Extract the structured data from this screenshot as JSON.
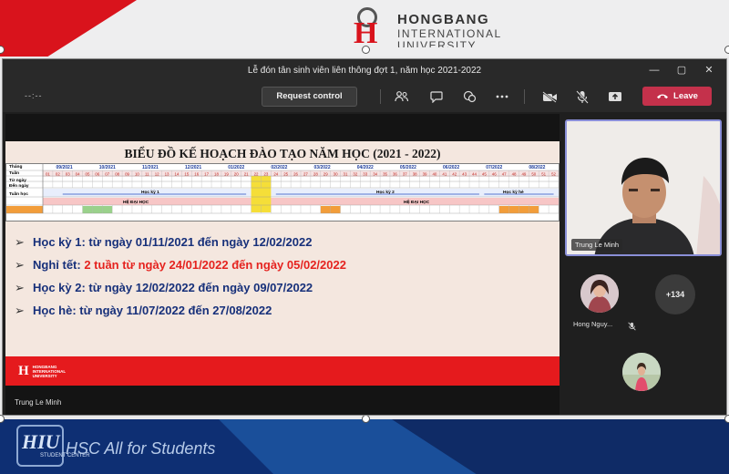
{
  "branding": {
    "logo_name": "HONGBANG",
    "logo_line2": "INTERNATIONAL",
    "logo_line3": "UNIVERSITY",
    "footer_logo": "HIU",
    "footer_logo_sub": "STUDENT CENTER",
    "slogan": "HSC All for Students"
  },
  "window": {
    "title": "Lễ đón tân sinh viên liên thông đợt 1, năm học 2021-2022",
    "controls": [
      "—",
      "▢",
      "✕"
    ]
  },
  "toolbar": {
    "timer": "--:--",
    "request_control": "Request control",
    "icons": [
      "people-icon",
      "chat-icon",
      "reactions-icon",
      "more-icon",
      "camera-off-icon",
      "mic-off-icon",
      "share-icon"
    ],
    "leave_label": "Leave"
  },
  "slide": {
    "title": "BIỂU ĐỒ KẾ HOẠCH ĐÀO TẠO NĂM HỌC (2021 - 2022)",
    "calendar": {
      "row_labels": [
        "Tháng",
        "Tuần",
        "Từ ngày",
        "Đến ngày",
        "Tuần học"
      ],
      "months": [
        "09/2021",
        "10/2021",
        "11/2021",
        "12/2021",
        "01/2022",
        "02/2022",
        "03/2022",
        "04/2022",
        "05/2022",
        "06/2022",
        "07/2022",
        "08/2022"
      ],
      "semesters": [
        "Học kỳ 1",
        "Học kỳ 2",
        "Học kỳ hè"
      ],
      "band_label": "HỆ ĐẠI HỌC"
    },
    "bullets": [
      {
        "label": "Học kỳ 1:",
        "text": " từ ngày 01/11/2021 đến ngày 12/02/2022",
        "highlight": false
      },
      {
        "label": "Nghỉ tết:",
        "text": " 2 tuần từ ngày 24/01/2022 đến ngày 05/02/2022",
        "highlight": true
      },
      {
        "label": "Học kỳ 2:",
        "text": " từ ngày 12/02/2022 đến ngày 09/07/2022",
        "highlight": false
      },
      {
        "label": "Học hè:",
        "text": " từ ngày 11/07/2022 đến 27/08/2022",
        "highlight": false
      }
    ],
    "footer_logo": "HONGBANG INTERNATIONAL UNIVERSITY",
    "presenter": "Trung Le Minh"
  },
  "panel": {
    "speaker_name": "Trung Le Minh",
    "participant_name": "Hong Nguy...",
    "more_count": "+134"
  },
  "colors": {
    "leave": "#c4314b",
    "brand_red": "#e51a1d",
    "text_blue": "#17307a",
    "accent_border": "#8a8fd8"
  }
}
